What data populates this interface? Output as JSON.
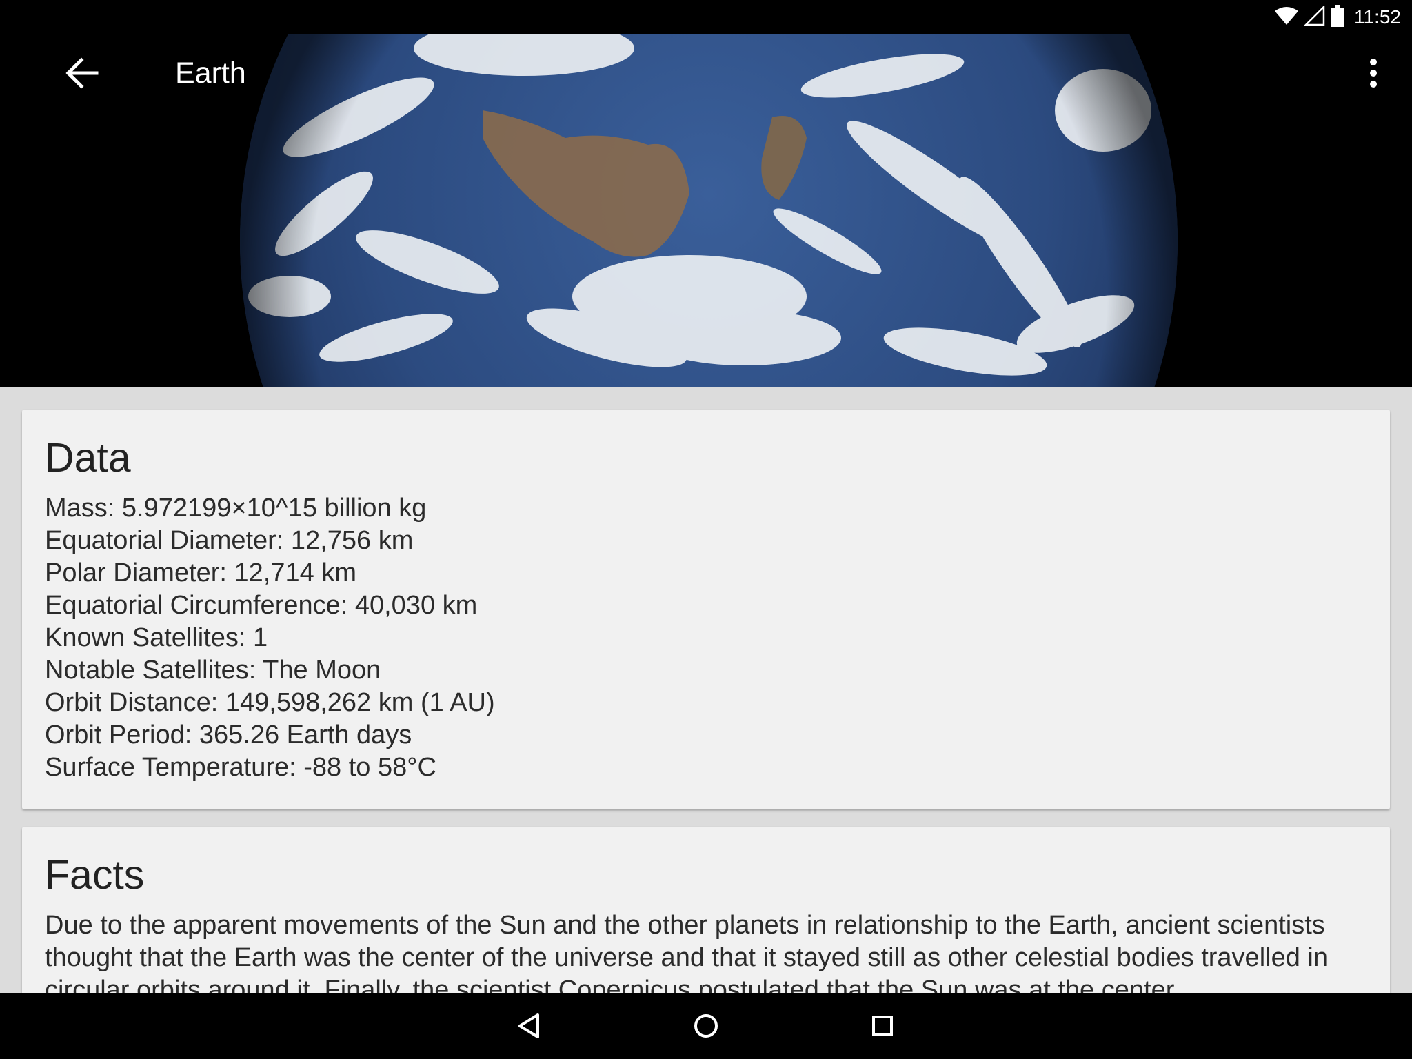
{
  "status_bar": {
    "time": "11:52",
    "icons": [
      "wifi-icon",
      "cell-signal-icon",
      "battery-icon"
    ]
  },
  "app_bar": {
    "title": "Earth",
    "back_icon": "arrow-back-icon",
    "menu_icon": "more-vert-icon"
  },
  "hero": {
    "image": "earth-photo"
  },
  "data_card": {
    "title": "Data",
    "items": [
      "Mass: 5.972199×10^15 billion kg",
      "Equatorial Diameter: 12,756 km",
      "Polar Diameter: 12,714 km",
      "Equatorial Circumference: 40,030 km",
      "Known Satellites: 1",
      "Notable Satellites: The Moon",
      "Orbit Distance: 149,598,262 km (1 AU)",
      "Orbit Period: 365.26 Earth days",
      "Surface Temperature: -88 to 58°C"
    ]
  },
  "facts_card": {
    "title": "Facts",
    "text": "Due to the apparent movements of the Sun and the other planets in relationship to the Earth, ancient scientists thought that the Earth was the center of the universe and that it stayed still as other celestial bodies travelled in circular orbits around it. Finally, the scientist Copernicus postulated that the Sun was at the center"
  },
  "nav_bar": {
    "icons": [
      "nav-back-icon",
      "nav-home-icon",
      "nav-recents-icon"
    ]
  },
  "colors": {
    "card_background": "#f1f1f1",
    "page_background": "#dcdcdc",
    "bar_background": "#000000",
    "text_primary": "#2b2b2b"
  }
}
